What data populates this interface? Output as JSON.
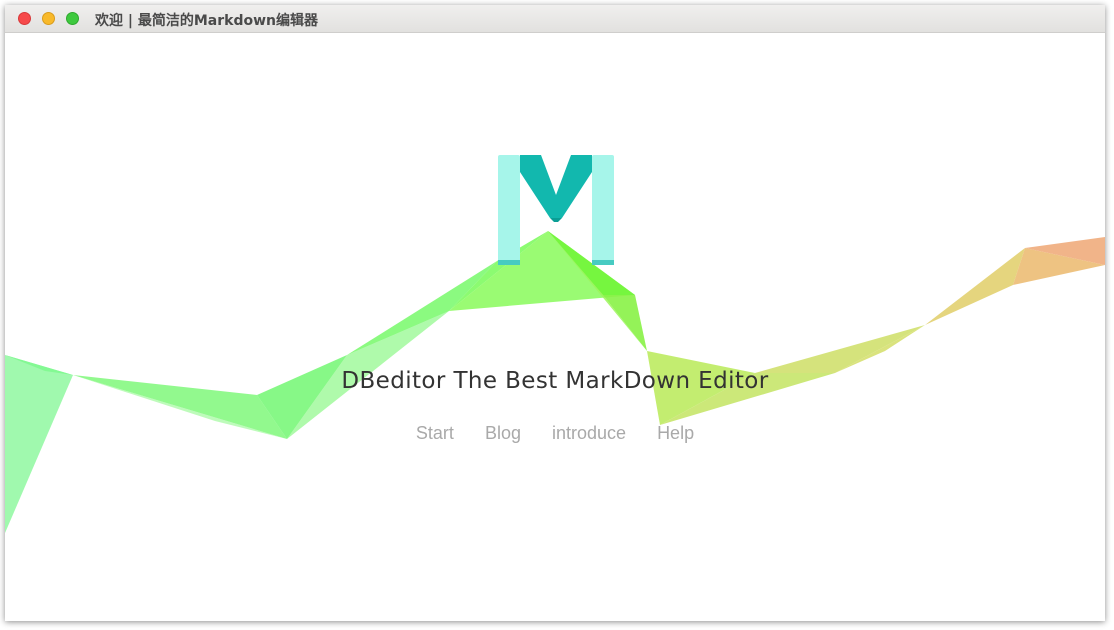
{
  "window": {
    "title": "欢迎 | 最简洁的Markdown编辑器"
  },
  "logo": {
    "letter": "M",
    "colors": {
      "light": "#a6f5ea",
      "dark": "#10b6ad"
    }
  },
  "hero": {
    "headline": "DBeditor The Best MarkDown Editor"
  },
  "nav": {
    "items": [
      "Start",
      "Blog",
      "introduce",
      "Help"
    ]
  },
  "colors": {
    "ribbon_green": "#7dfc5a",
    "ribbon_yellow": "#d4e070",
    "ribbon_orange": "#f0b07a",
    "text_dark": "#333333",
    "link_gray": "#a9a9a9"
  }
}
